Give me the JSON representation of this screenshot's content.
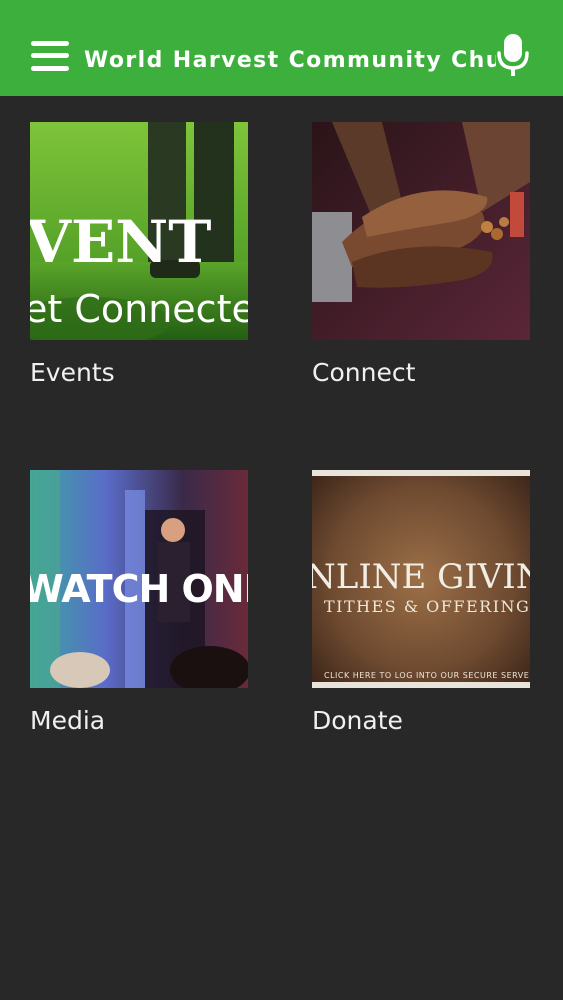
{
  "header": {
    "title": "World Harvest Community Church",
    "menu_icon": "hamburger-menu-icon",
    "voice_icon": "microphone-icon",
    "color": "#3daf3d"
  },
  "tiles": [
    {
      "label": "Events",
      "image_text": [
        "VENT",
        "et Connecte"
      ]
    },
    {
      "label": "Connect"
    },
    {
      "label": "Media",
      "image_text": [
        "WATCH ONLIN"
      ]
    },
    {
      "label": "Donate",
      "image_text": [
        "NLINE GIVIN",
        "TITHES & OFFERINGS",
        "CLICK HERE TO LOG INTO OUR SECURE SERVER"
      ]
    }
  ]
}
